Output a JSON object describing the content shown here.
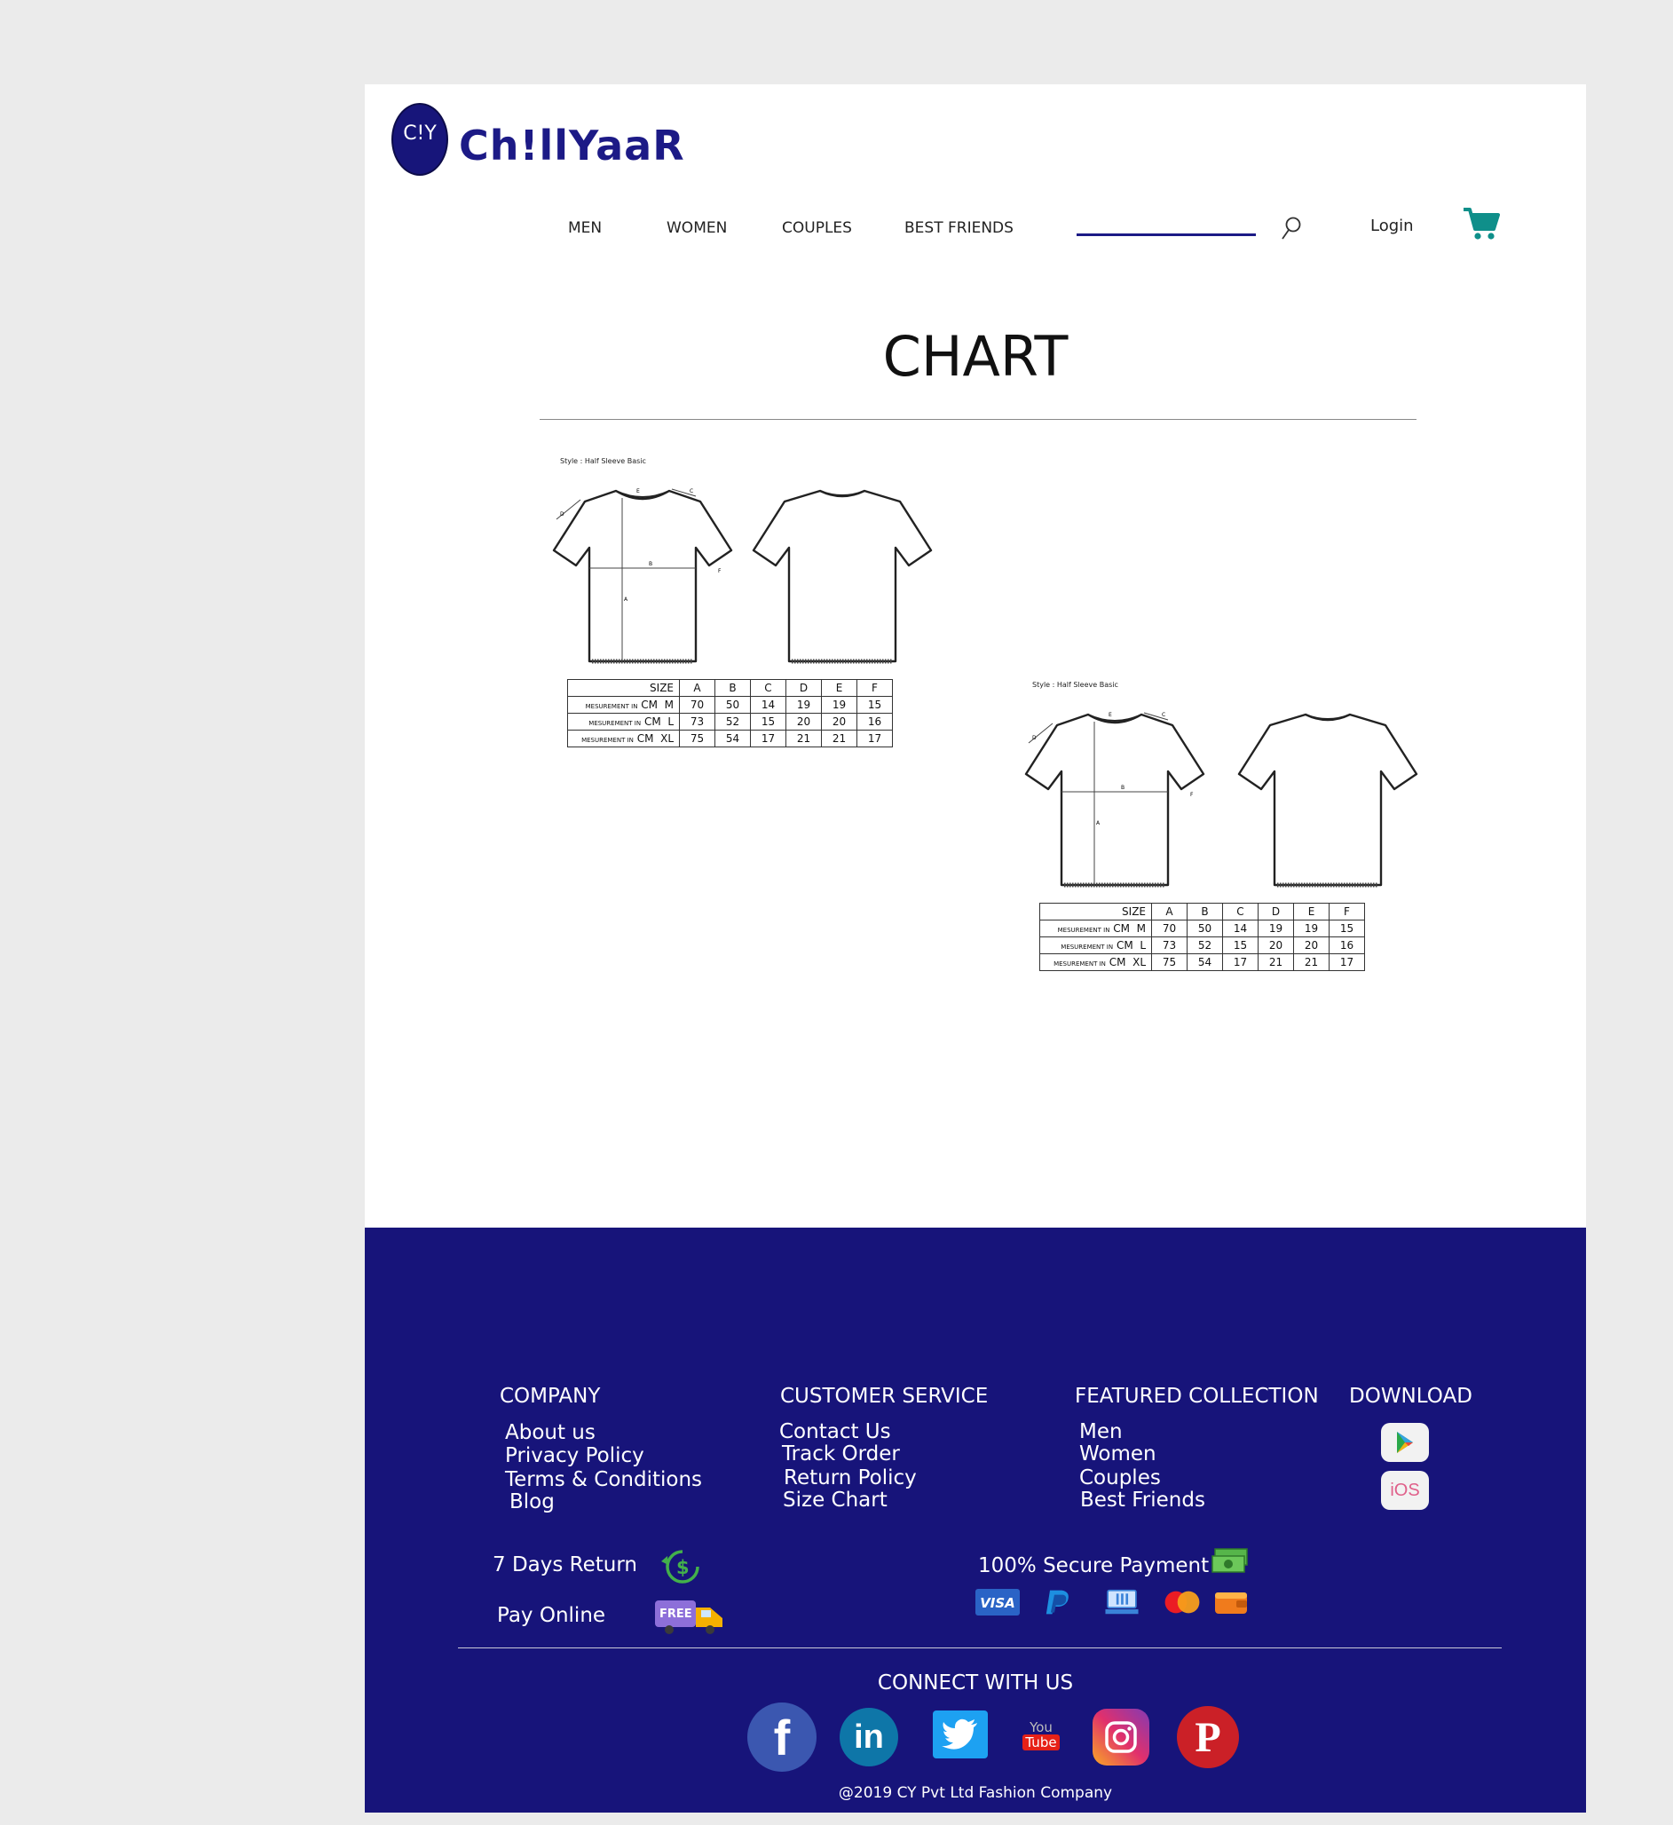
{
  "header": {
    "logo_mark": "C!Y",
    "logo_text": "Ch!llYaaR",
    "nav": [
      "MEN",
      "WOMEN",
      "COUPLES",
      "BEST FRIENDS"
    ],
    "login_label": "Login",
    "brand_color": "#17157a",
    "cart_color": "#0f8f8a"
  },
  "main": {
    "title": "CHART",
    "size_charts": [
      {
        "style_note": "Style : Half Sleeve Basic",
        "measure_letters": [
          "E",
          "C",
          "D",
          "B",
          "F",
          "A"
        ],
        "header_label": "SIZE",
        "columns": [
          "A",
          "B",
          "C",
          "D",
          "E",
          "F"
        ],
        "row_prefix": "MESUREMENT IN",
        "unit": "CM",
        "rows": [
          {
            "size": "M",
            "values": [
              "70",
              "50",
              "14",
              "19",
              "19",
              "15"
            ]
          },
          {
            "size": "L",
            "values": [
              "73",
              "52",
              "15",
              "20",
              "20",
              "16"
            ]
          },
          {
            "size": "XL",
            "values": [
              "75",
              "54",
              "17",
              "21",
              "21",
              "17"
            ]
          }
        ]
      },
      {
        "style_note": "Style : Half Sleeve Basic",
        "measure_letters": [
          "E",
          "C",
          "D",
          "B",
          "F",
          "A"
        ],
        "header_label": "SIZE",
        "columns": [
          "A",
          "B",
          "C",
          "D",
          "E",
          "F"
        ],
        "row_prefix": "MESUREMENT IN",
        "unit": "CM",
        "rows": [
          {
            "size": "M",
            "values": [
              "70",
              "50",
              "14",
              "19",
              "19",
              "15"
            ]
          },
          {
            "size": "L",
            "values": [
              "73",
              "52",
              "15",
              "20",
              "20",
              "16"
            ]
          },
          {
            "size": "XL",
            "values": [
              "75",
              "54",
              "17",
              "21",
              "21",
              "17"
            ]
          }
        ]
      }
    ]
  },
  "footer": {
    "background": "#17147a",
    "company": {
      "heading": "COMPANY",
      "links": [
        "About us",
        "Privacy Policy",
        "Terms & Conditions",
        "Blog"
      ]
    },
    "customer_service": {
      "heading": "CUSTOMER SERVICE",
      "links": [
        "Contact Us",
        "Track Order",
        "Return Policy",
        "Size Chart"
      ]
    },
    "featured": {
      "heading": "FEATURED COLLECTION",
      "links": [
        "Men",
        "Women",
        "Couples",
        "Best Friends"
      ]
    },
    "download": {
      "heading": "DOWNLOAD",
      "ios_label": "iOS"
    },
    "returns_label": "7  Days Return",
    "pay_online_label": "Pay Online",
    "free_label": "FREE",
    "secure_payment_label": "100% Secure Payment",
    "visa_label": "VISA",
    "connect_label": "CONNECT WITH US",
    "youtube_label": "You",
    "youtube_label_2": "Tube",
    "copyright": "@2019 CY Pvt Ltd Fashion Company"
  }
}
